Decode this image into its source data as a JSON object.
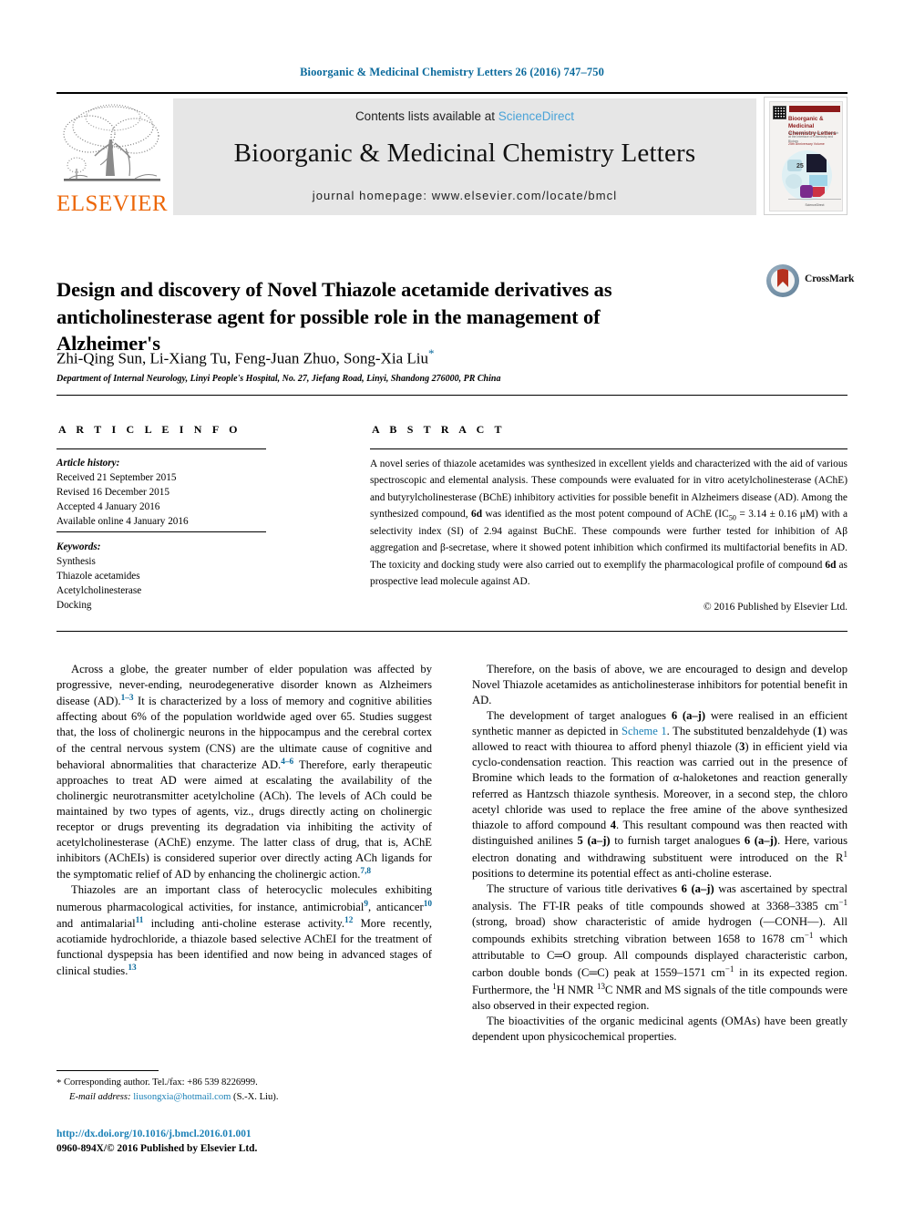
{
  "running_head": "Bioorganic & Medicinal Chemistry Letters 26 (2016) 747–750",
  "masthead": {
    "publisher_word": "ELSEVIER",
    "contents_prefix": "Contents lists available at ",
    "contents_link": "ScienceDirect",
    "journal_title": "Bioorganic & Medicinal Chemistry Letters",
    "homepage": "journal homepage: www.elsevier.com/locate/bmcl",
    "cover": {
      "title": "Bioorganic & Medicinal Chemistry Letters",
      "subtitle": "An international journal for Research at the Interface of Chemistry and Biology",
      "edition": "25th Anniversary Volume",
      "badge": "25",
      "footer": "ScienceDirect"
    }
  },
  "article": {
    "title": "Design and discovery of Novel Thiazole acetamide derivatives as anticholinesterase agent for possible role in the management of Alzheimer's",
    "authors": "Zhi-Qing Sun, Li-Xiang Tu, Feng-Juan Zhuo, Song-Xia Liu",
    "corresponding_marker": "*",
    "affiliation": "Department of Internal Neurology, Linyi People's Hospital, No. 27, Jiefang Road, Linyi, Shandong 276000, PR China",
    "crossmark_label": "CrossMark"
  },
  "article_info": {
    "heading": "A R T I C L E   I N F O",
    "history_label": "Article history:",
    "history": [
      "Received 21 September 2015",
      "Revised 16 December 2015",
      "Accepted 4 January 2016",
      "Available online 4 January 2016"
    ],
    "keywords_label": "Keywords:",
    "keywords": [
      "Synthesis",
      "Thiazole acetamides",
      "Acetylcholinesterase",
      "Docking"
    ]
  },
  "abstract": {
    "heading": "A B S T R A C T",
    "text_part1": "A novel series of thiazole acetamides was synthesized in excellent yields and characterized with the aid of various spectroscopic and elemental analysis. These compounds were evaluated for in vitro acetylcholinesterase (AChE) and butyrylcholinesterase (BChE) inhibitory activities for possible benefit in Alzheimers disease (AD). Among the synthesized compound, ",
    "bold1": "6d",
    "text_part2": " was identified as the most potent compound of AChE (IC",
    "sub1": "50",
    "text_part3": " = 3.14 ± 0.16 μM) with a selectivity index (SI) of 2.94 against BuChE. These compounds were further tested for inhibition of Aβ aggregation and β-secretase, where it showed potent inhibition which confirmed its multifactorial benefits in AD. The toxicity and docking study were also carried out to exemplify the pharmacological profile of compound ",
    "bold2": "6d",
    "text_part4": " as prospective lead molecule against AD.",
    "copyright": "© 2016 Published by Elsevier Ltd."
  },
  "body": {
    "left": {
      "p1_a": "Across a globe, the greater number of elder population was affected by progressive, never-ending, neurodegenerative disorder known as Alzheimers disease (AD).",
      "p1_ref1": "1–3",
      "p1_b": " It is characterized by a loss of memory and cognitive abilities affecting about 6% of the population worldwide aged over 65. Studies suggest that, the loss of cholinergic neurons in the hippocampus and the cerebral cortex of the central nervous system (CNS) are the ultimate cause of cognitive and behavioral abnormalities that characterize AD.",
      "p1_ref2": "4–6",
      "p1_c": " Therefore, early therapeutic approaches to treat AD were aimed at escalating the availability of the cholinergic neurotransmitter acetylcholine (ACh). The levels of ACh could be maintained by two types of agents, viz., drugs directly acting on cholinergic receptor or drugs preventing its degradation via inhibiting the activity of acetylcholinesterase (AChE) enzyme. The latter class of drug, that is, AChE inhibitors (AChEIs) is considered superior over directly acting ACh ligands for the symptomatic relief of AD by enhancing the cholinergic action.",
      "p1_ref3": "7,8",
      "p2_a": "Thiazoles are an important class of heterocyclic molecules exhibiting numerous pharmacological activities, for instance, antimicrobial",
      "p2_ref1": "9",
      "p2_b": ", anticancer",
      "p2_ref2": "10",
      "p2_c": " and antimalarial",
      "p2_ref3": "11",
      "p2_d": " including anti-choline esterase activity.",
      "p2_ref4": "12",
      "p2_e": " More recently, acotiamide hydrochloride, a thiazole based selective AChEI for the treatment of functional dyspepsia has been identified and now being in advanced stages of clinical studies.",
      "p2_ref5": "13"
    },
    "right": {
      "p1": "Therefore, on the basis of above, we are encouraged to design and develop Novel Thiazole acetamides as anticholinesterase inhibitors for potential benefit in AD.",
      "p2_a": "The development of target analogues ",
      "p2_b1": "6 (a–j)",
      "p2_c": " were realised in an efficient synthetic manner as depicted in ",
      "p2_link": "Scheme 1",
      "p2_d": ". The substituted benzaldehyde (",
      "p2_b2": "1",
      "p2_e": ") was allowed to react with thiourea to afford phenyl thiazole (",
      "p2_b3": "3",
      "p2_f": ") in efficient yield via cyclo-condensation reaction. This reaction was carried out in the presence of Bromine which leads to the formation of α-haloketones and reaction generally referred as Hantzsch thiazole synthesis. Moreover, in a second step, the chloro acetyl chloride was used to replace the free amine of the above synthesized thiazole to afford compound ",
      "p2_b4": "4",
      "p2_g": ". This resultant compound was then reacted with distinguished anilines ",
      "p2_b5": "5 (a–j)",
      "p2_h": " to furnish target analogues ",
      "p2_b6": "6 (a–j)",
      "p2_i": ". Here, various electron donating and withdrawing substituent were introduced on the R",
      "p2_sup": "1",
      "p2_j": " positions to determine its potential effect as anti-choline esterase.",
      "p3_a": "The structure of various title derivatives ",
      "p3_b1": "6 (a–j)",
      "p3_c": " was ascertained by spectral analysis. The FT-IR peaks of title compounds showed at 3368–3385 cm",
      "p3_sup1": "−1",
      "p3_d": " (strong, broad) show characteristic of amide hydrogen (—CONH—). All compounds exhibits stretching vibration between 1658 to 1678 cm",
      "p3_sup2": "−1",
      "p3_e": " which attributable to C═O group. All compounds displayed characteristic carbon, carbon double bonds (C═C) peak at 1559–1571 cm",
      "p3_sup3": "−1",
      "p3_f": " in its expected region. Furthermore, the ",
      "p3_sup4": "1",
      "p3_g": "H NMR ",
      "p3_sup5": "13",
      "p3_h": "C NMR and MS signals of the title compounds were also observed in their expected region.",
      "p4": "The bioactivities of the organic medicinal agents (OMAs) have been greatly dependent upon physicochemical properties."
    }
  },
  "footnote": {
    "star": "*",
    "corresponding": "Corresponding author. Tel./fax: +86 539 8226999.",
    "email_label": "E-mail address:",
    "email": "liusongxia@hotmail.com",
    "email_suffix": "(S.-X. Liu)."
  },
  "footer": {
    "doi": "http://dx.doi.org/10.1016/j.bmcl.2016.01.001",
    "issn_line": "0960-894X/© 2016 Published by Elsevier Ltd."
  },
  "colors": {
    "link": "#1a80b6",
    "runhead": "#0b6a9c",
    "elsevier_orange": "#ec6608",
    "sciencedirect": "#4aa3d8",
    "cover_maroon": "#8e1b1b"
  }
}
